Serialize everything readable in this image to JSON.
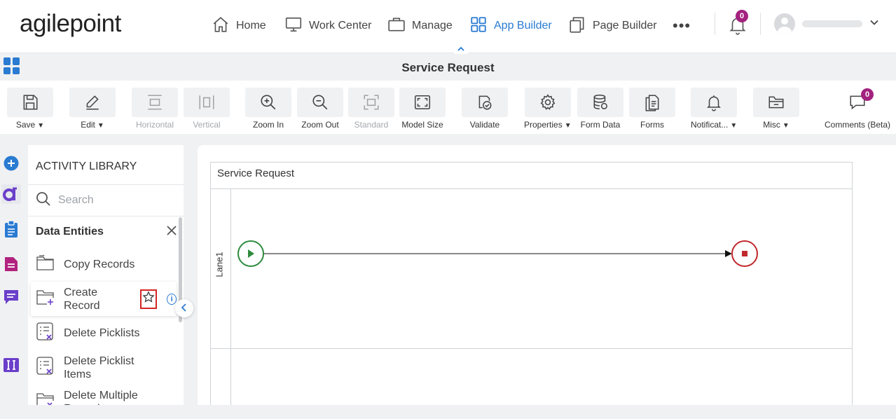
{
  "logo": "agilepoint",
  "nav": {
    "home": "Home",
    "work_center": "Work Center",
    "manage": "Manage",
    "app_builder": "App Builder",
    "page_builder": "Page Builder",
    "more": "•••",
    "notifications_count": "0"
  },
  "page_title": "Service Request",
  "toolbar": {
    "save": "Save",
    "edit": "Edit",
    "horizontal": "Horizontal",
    "vertical": "Vertical",
    "zoom_in": "Zoom In",
    "zoom_out": "Zoom Out",
    "standard": "Standard",
    "model_size": "Model Size",
    "validate": "Validate",
    "properties": "Properties",
    "form_data": "Form Data",
    "forms": "Forms",
    "notifications": "Notificat...",
    "misc": "Misc",
    "comments": "Comments (Beta)",
    "comments_count": "0"
  },
  "library": {
    "header": "ACTIVITY LIBRARY",
    "search_placeholder": "Search",
    "category": "Data Entities",
    "items": [
      {
        "label": "Copy Records"
      },
      {
        "label": "Create Record"
      },
      {
        "label": "Delete Picklists"
      },
      {
        "label": "Delete Picklist Items"
      },
      {
        "label": "Delete Multiple Records"
      }
    ]
  },
  "canvas": {
    "pool_title": "Service Request",
    "lane_label": "Lane1"
  },
  "colors": {
    "accent": "#2a7bd2",
    "badge": "#a3227e",
    "start": "#2e8b3e",
    "end": "#c0282d",
    "highlight_box": "#d32626"
  }
}
